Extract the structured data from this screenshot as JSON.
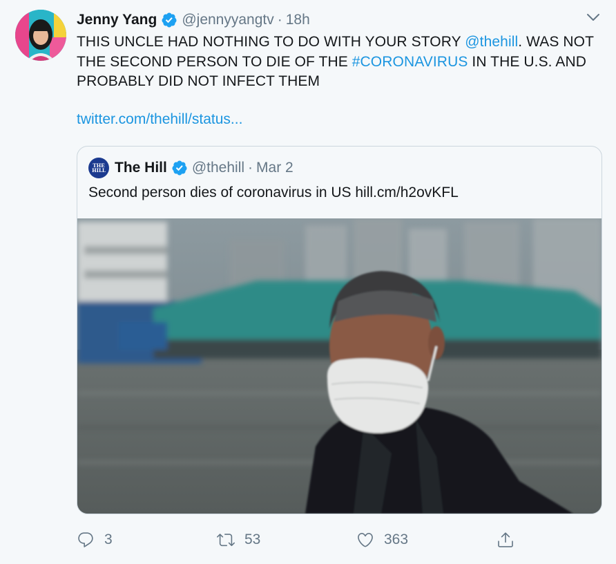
{
  "tweet": {
    "author_name": "Jenny Yang",
    "author_handle": "@jennyyangtv",
    "separator": "·",
    "time": "18h",
    "text_part1": "THIS UNCLE HAD NOTHING TO DO WITH YOUR STORY ",
    "mention": "@thehill",
    "text_part2": ". WAS NOT THE SECOND PERSON TO DIE OF THE ",
    "hashtag": "#CORONAVIRUS",
    "text_part3": " IN THE U.S. AND PROBABLY DID NOT INFECT THEM",
    "link": "twitter.com/thehill/status..."
  },
  "quoted": {
    "logo_text_line1": "THE",
    "logo_text_line2": "HILL",
    "author_name": "The Hill",
    "author_handle": "@thehill",
    "separator": "·",
    "time": "Mar 2",
    "text": "Second person dies of coronavirus in US hill.cm/h2ovKFL"
  },
  "actions": {
    "replies": "3",
    "retweets": "53",
    "likes": "363"
  },
  "icons": [
    "verified-badge-icon",
    "chevron-down-icon",
    "reply-icon",
    "retweet-icon",
    "like-icon",
    "share-icon"
  ],
  "colors": {
    "link": "#1b95e0",
    "verified": "#1da1f2",
    "muted": "#657786",
    "background": "#f5f8fa"
  }
}
